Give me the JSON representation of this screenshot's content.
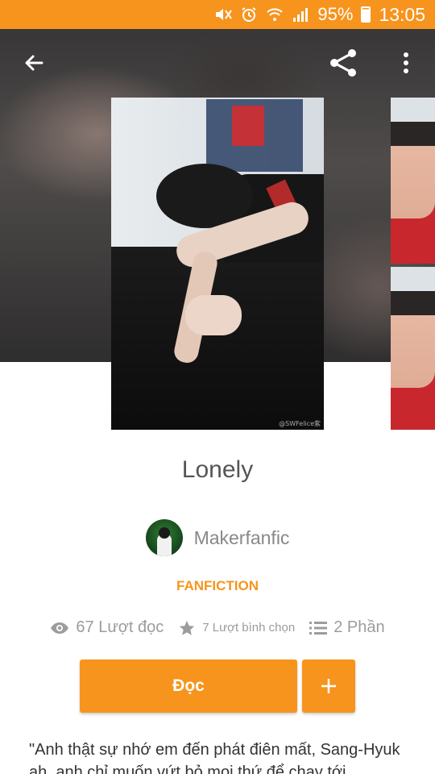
{
  "status_bar": {
    "battery_percent": "95%",
    "time": "13:05",
    "icons": [
      "mute-icon",
      "alarm-icon",
      "wifi-icon",
      "signal-icon",
      "battery-icon"
    ]
  },
  "toolbar": {
    "back_icon": "arrow-left-icon",
    "share_icon": "share-icon",
    "more_icon": "more-vertical-icon"
  },
  "cover": {
    "watermark": "@SWFelice紫"
  },
  "story": {
    "title": "Lonely",
    "author": "Makerfanfic",
    "category": "FANFICTION",
    "reads": "67 Lượt đọc",
    "votes": "7 Lượt bình chọn",
    "parts": "2 Phần",
    "description": "\"Anh thật sự nhớ em đến phát điên mất, Sang-Hyuk ah, anh chỉ muốn vứt bỏ mọi thứ để chạy tới"
  },
  "actions": {
    "read_label": "Đọc",
    "add_label": "+"
  },
  "colors": {
    "accent": "#f7941d",
    "text_gray": "#9c9c9c"
  }
}
